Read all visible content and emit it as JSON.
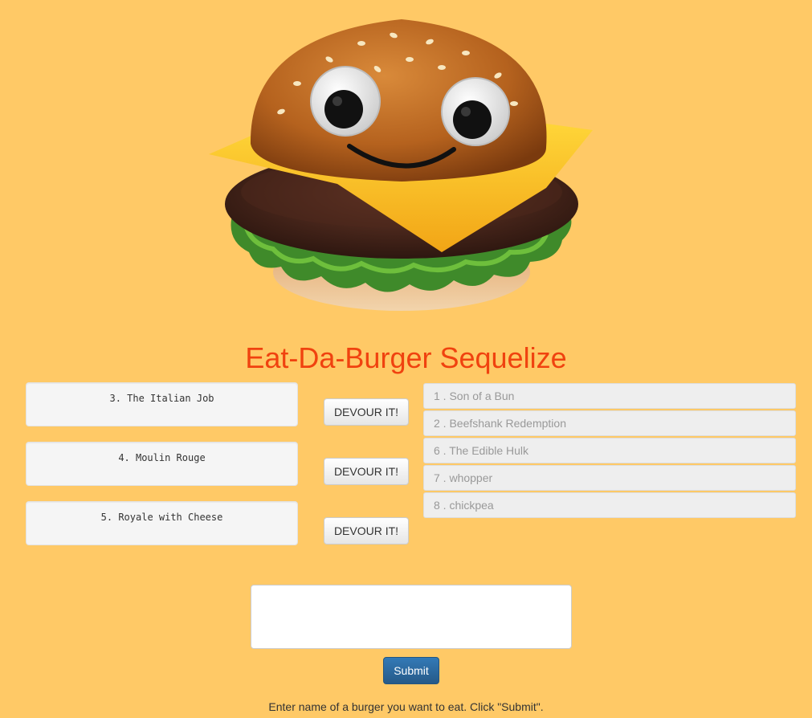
{
  "page": {
    "title": "Eat-Da-Burger Sequelize",
    "background_color": "#ffc966",
    "title_color": "#f0420f"
  },
  "uneaten_burgers": [
    {
      "label": "3. The Italian Job",
      "button_label": "DEVOUR IT!"
    },
    {
      "label": "4. Moulin Rouge",
      "button_label": "DEVOUR IT!"
    },
    {
      "label": "5. Royale with Cheese",
      "button_label": "DEVOUR IT!"
    }
  ],
  "devoured_burgers": [
    {
      "label": "1 . Son of a Bun"
    },
    {
      "label": "2 . Beefshank Redemption"
    },
    {
      "label": "6 . The Edible Hulk"
    },
    {
      "label": "7 . whopper"
    },
    {
      "label": "8 . chickpea"
    }
  ],
  "form": {
    "textarea_value": "",
    "submit_label": "Submit",
    "instructions": "Enter name of a burger you want to eat. Click \"Submit\"."
  },
  "images": {
    "mascot": "smiling-cheeseburger-with-googly-eyes"
  }
}
